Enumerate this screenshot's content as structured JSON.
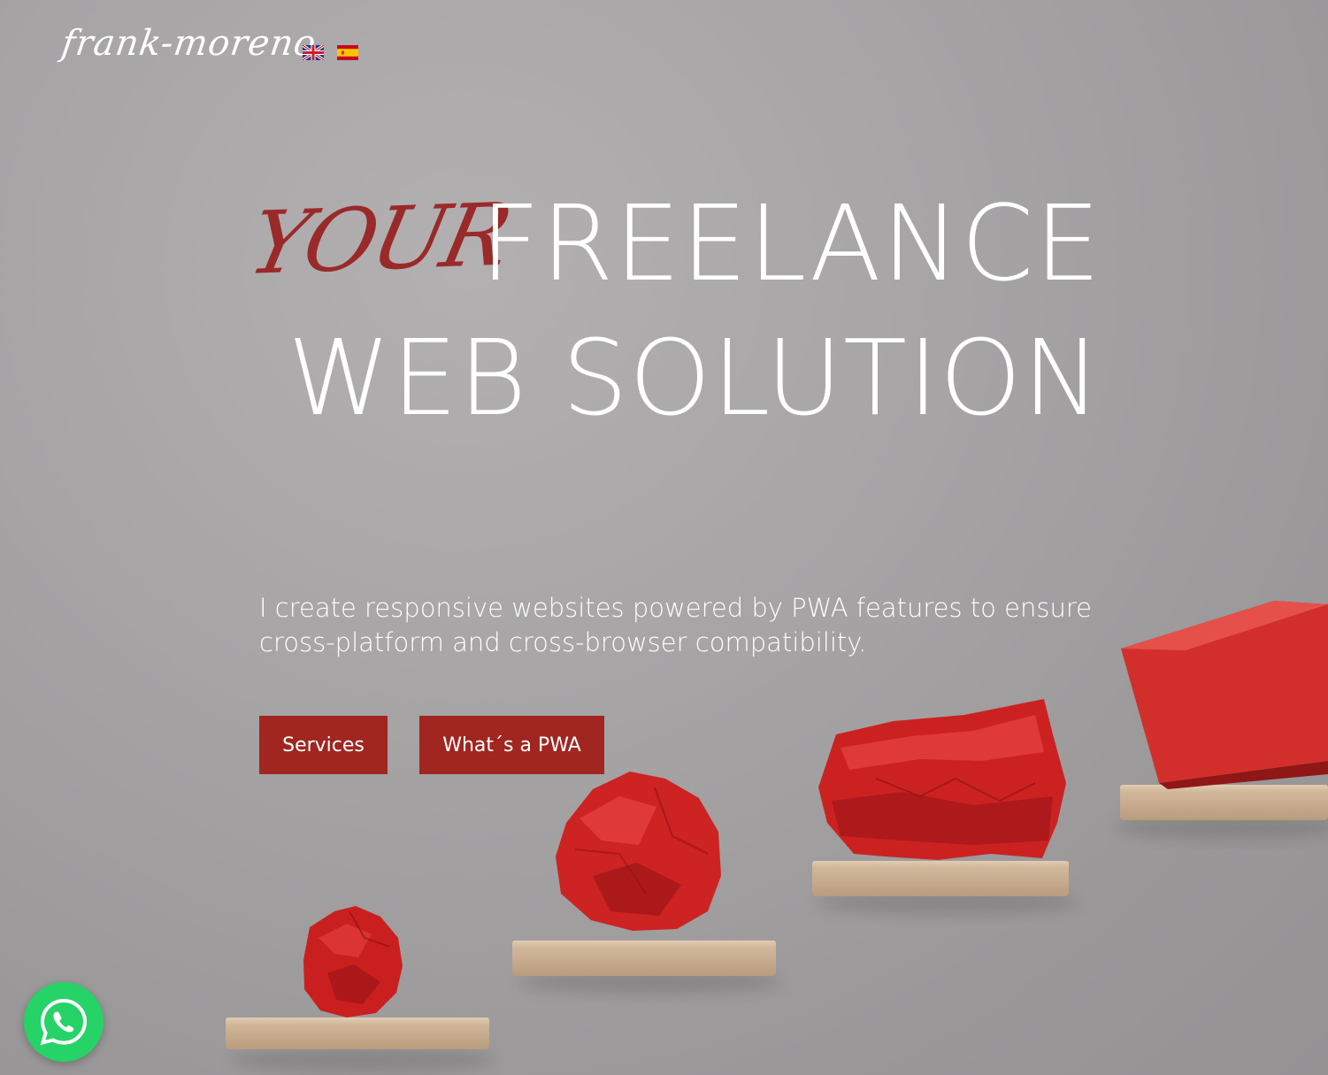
{
  "header": {
    "logo_text": "frank-moreno",
    "languages": [
      {
        "code": "en",
        "icon": "uk-flag-icon"
      },
      {
        "code": "es",
        "icon": "spain-flag-icon"
      }
    ]
  },
  "hero": {
    "accent_word": "YOUR",
    "line1": "FREELANCE",
    "line2": "WEB SOLUTION",
    "tagline": "I create responsive websites powered by PWA features to ensure cross-platform and cross-browser compatibility.",
    "buttons": {
      "services": "Services",
      "pwa": "What´s a PWA"
    }
  },
  "floating": {
    "whatsapp_icon": "whatsapp-icon"
  },
  "colors": {
    "accent": "#a0261f",
    "accent_word": "#9a2a2a",
    "background": "#a6a4a5",
    "whatsapp": "#25d366"
  }
}
